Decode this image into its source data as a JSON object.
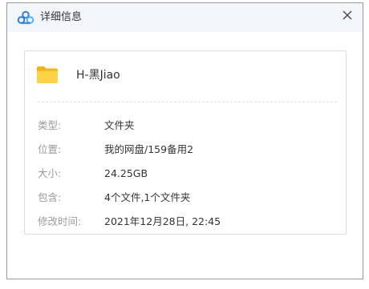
{
  "window": {
    "title": "详细信息",
    "app_icon": "baidu-netdisk-cloud-icon",
    "close_icon": "close-icon"
  },
  "file": {
    "icon": "folder-icon",
    "name": "H-黑Jiao"
  },
  "details": [
    {
      "label": "类型:",
      "value": "文件夹"
    },
    {
      "label": "位置:",
      "value": "我的网盘/159备用2"
    },
    {
      "label": "大小:",
      "value": "24.25GB"
    },
    {
      "label": "包含:",
      "value": "4个文件,1个文件夹"
    },
    {
      "label": "修改时间:",
      "value": "2021年12月28日, 22:45"
    }
  ],
  "colors": {
    "titlebar_bg": "#f2f6fb",
    "folder": "#f9c52c",
    "label": "#9a9a9a",
    "value": "#333333"
  }
}
